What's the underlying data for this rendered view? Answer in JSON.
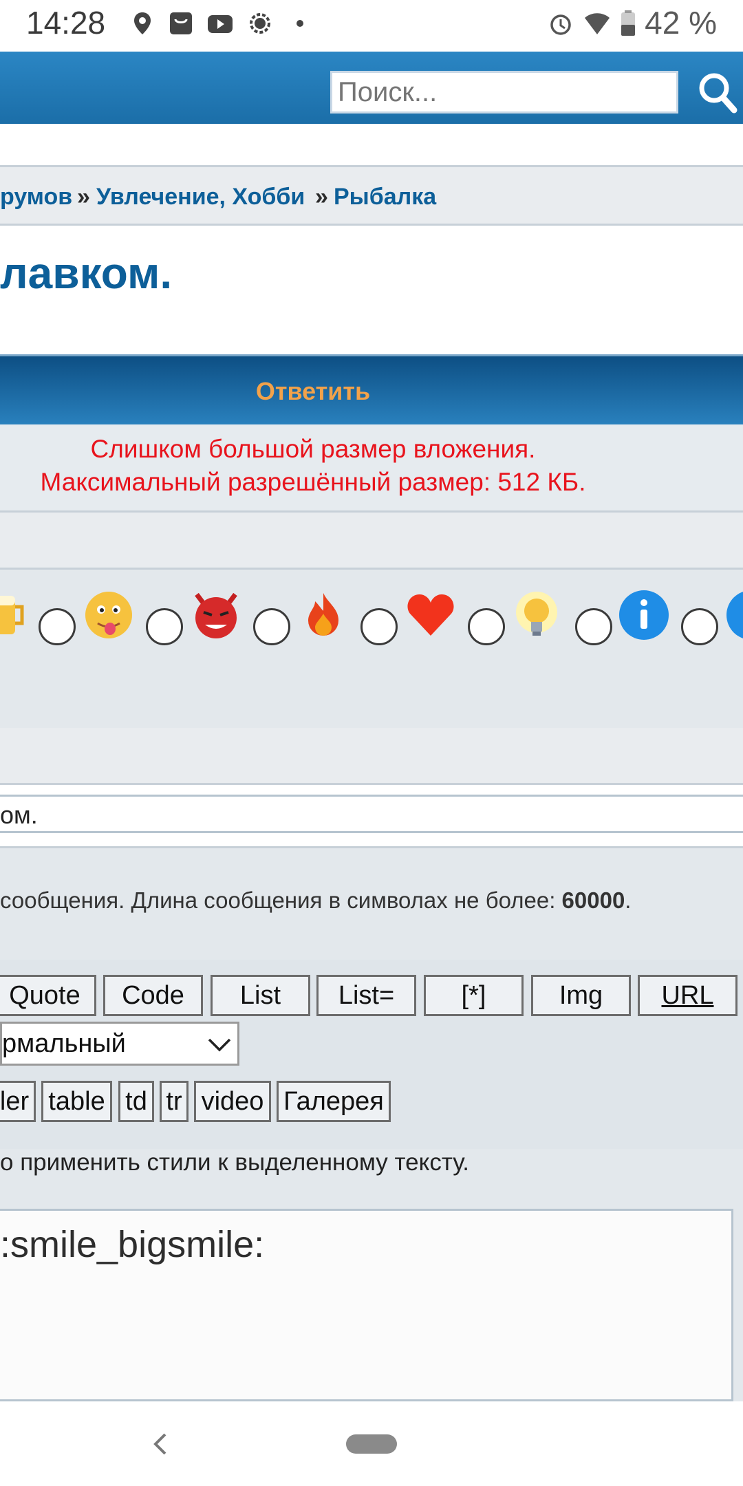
{
  "status": {
    "time": "14:28",
    "battery": "42 %"
  },
  "header": {
    "search_placeholder": "Поиск..."
  },
  "breadcrumb": {
    "items": [
      "румов",
      "Увлечение, Хобби",
      "Рыбалка"
    ],
    "separator": "»"
  },
  "topic_title": "лавком.",
  "reply_label": "Ответить",
  "error": {
    "line1": "Слишком большой размер вложения.",
    "line2": "Максимальный разрешённый размер: 512 КБ."
  },
  "smilies": [
    "beer-icon",
    "tongue-smiley-icon",
    "devil-smiley-icon",
    "fire-icon",
    "heart-icon",
    "lightbulb-icon",
    "info-icon"
  ],
  "subject_value": "ом.",
  "length_hint": {
    "text": "сообщения. Длина сообщения в символах не более: ",
    "limit": "60000",
    "end": "."
  },
  "bbcode_buttons": [
    "Quote",
    "Code",
    "List",
    "List=",
    "[*]",
    "Img",
    "URL"
  ],
  "font_size_select": "рмальный",
  "bbcode_buttons2": [
    "ler",
    "table",
    "td",
    "tr",
    "video",
    "Галерея"
  ],
  "style_hint": "о применить стили к выделенному тексту.",
  "message_text": ":smile_bigsmile:",
  "colors": {
    "header_blue": "#1b6ea8",
    "link_blue": "#0d5f99",
    "reply_orange": "#f2a24a",
    "error_red": "#e8141d"
  }
}
